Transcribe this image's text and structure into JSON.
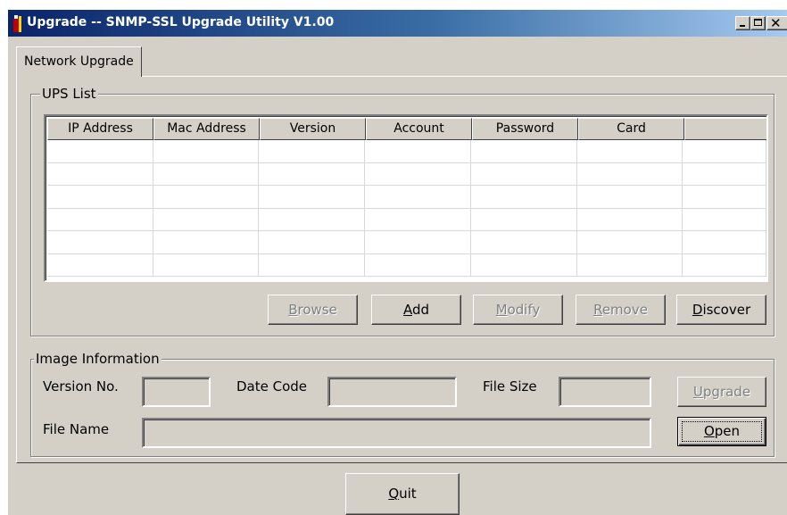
{
  "window": {
    "title": "Upgrade -- SNMP-SSL Upgrade Utility V1.00",
    "icon": "app-icon",
    "controls": [
      "minimize-icon",
      "maximize-icon",
      "close-icon"
    ]
  },
  "tabs": [
    {
      "label": "Network Upgrade",
      "selected": true
    }
  ],
  "ups_list": {
    "label": "UPS List",
    "columns": [
      "IP Address",
      "Mac Address",
      "Version",
      "Account",
      "Password",
      "Card",
      ""
    ],
    "rows": [],
    "buttons": {
      "browse": {
        "label": "Browse",
        "enabled": false,
        "mnemonic": "B",
        "rest": "rowse"
      },
      "add": {
        "label": "Add",
        "enabled": true,
        "mnemonic": "A",
        "rest": "dd"
      },
      "modify": {
        "label": "Modify",
        "enabled": false,
        "mnemonic": "M",
        "rest": "odify"
      },
      "remove": {
        "label": "Remove",
        "enabled": false,
        "mnemonic": "R",
        "rest": "emove"
      },
      "discover": {
        "label": "Discover",
        "enabled": true,
        "mnemonic": "D",
        "rest": "iscover"
      }
    }
  },
  "image_info": {
    "label": "Image Information",
    "version_label": "Version No.",
    "version_value": "",
    "date_code_label": "Date Code",
    "date_code_value": "",
    "file_size_label": "File Size",
    "file_size_value": "",
    "file_name_label": "File Name",
    "file_name_value": "",
    "upgrade": {
      "label": "Upgrade",
      "enabled": false,
      "mnemonic": "U",
      "rest": "pgrade"
    },
    "open": {
      "label": "Open",
      "enabled": true,
      "mnemonic": "O",
      "rest": "pen"
    }
  },
  "quit": {
    "label": "Quit",
    "mnemonic": "Q",
    "rest": "uit"
  },
  "colors": {
    "face": "#d4d0c8",
    "title_start": "#0a246a",
    "title_end": "#a6caf0",
    "disabled_text": "#808080"
  }
}
